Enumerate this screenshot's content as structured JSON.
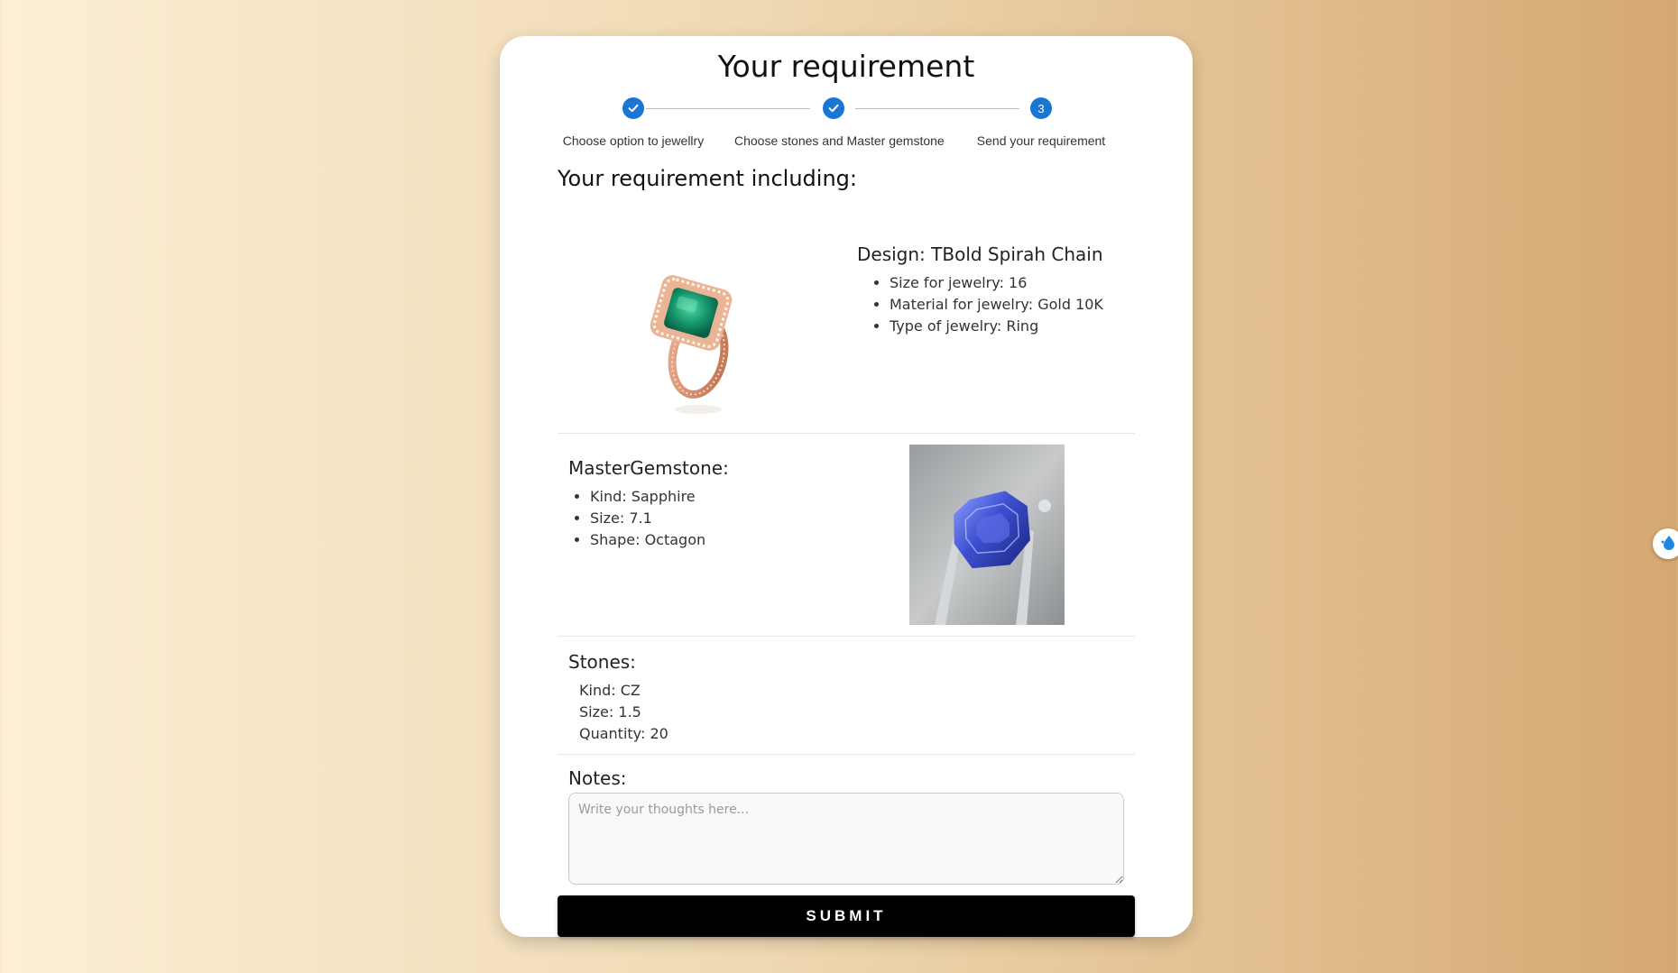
{
  "title": "Your requirement",
  "stepper": {
    "steps": [
      {
        "label": "Choose option to jewellry",
        "state": "completed"
      },
      {
        "label": "Choose stones and Master gemstone",
        "state": "completed"
      },
      {
        "label": "Send your requirement",
        "state": "active",
        "number": "3"
      }
    ]
  },
  "summary_heading": "Your requirement including:",
  "design": {
    "title": "Design: TBold Spirah Chain",
    "items": [
      "Size for jewelry: 16",
      "Material for jewelry: Gold 10K",
      "Type of jewelry: Ring"
    ]
  },
  "master_gemstone": {
    "title": "MasterGemstone:",
    "items": [
      "Kind: Sapphire",
      "Size: 7.1",
      "Shape: Octagon"
    ]
  },
  "stones": {
    "title": "Stones:",
    "items": [
      "Kind: CZ",
      "Size: 1.5",
      "Quantity: 20"
    ]
  },
  "notes": {
    "title": "Notes:",
    "placeholder": "Write your thoughts here...",
    "value": ""
  },
  "submit_label": "SUBMIT",
  "colors": {
    "primary": "#1976d2",
    "button": "#000000"
  },
  "icons": {
    "step_done": "check-icon",
    "side_widget": "water-drop-icon"
  }
}
